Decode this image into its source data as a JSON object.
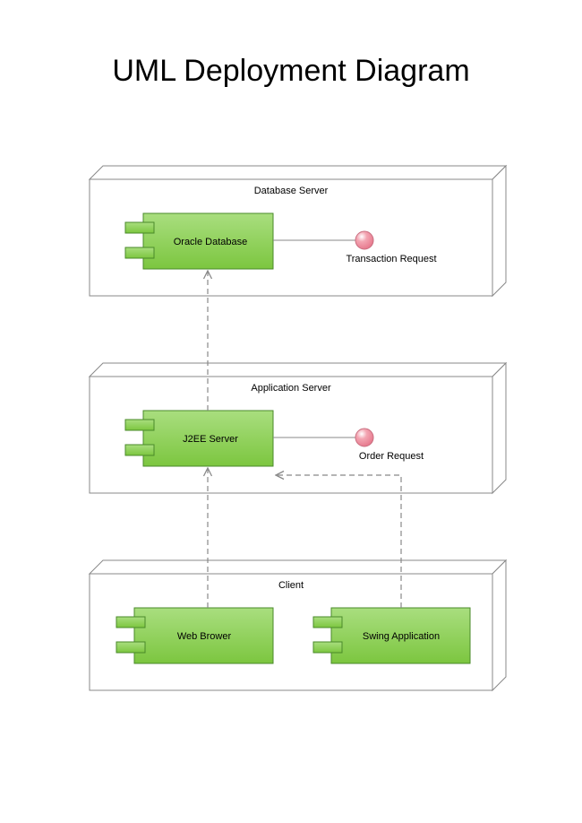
{
  "title": "UML Deployment Diagram",
  "nodes": {
    "db": {
      "label": "Database Server"
    },
    "app": {
      "label": "Application Server"
    },
    "client": {
      "label": "Client"
    }
  },
  "components": {
    "oracle": {
      "label": "Oracle Database"
    },
    "j2ee": {
      "label": "J2EE Server"
    },
    "web": {
      "label": "Web Brower"
    },
    "swing": {
      "label": "Swing Application"
    }
  },
  "interfaces": {
    "transaction": {
      "label": "Transaction Request"
    },
    "order": {
      "label": "Order Request"
    }
  },
  "colors": {
    "componentFill": "#7cc63f",
    "componentFillLight": "#a9de7f",
    "componentStroke": "#4a8a2a",
    "ballFill": "#f3a5b2",
    "ballHighlight": "#ffffff",
    "ballStroke": "#c96f80",
    "boxStroke": "#888888",
    "dash": "#888888"
  }
}
